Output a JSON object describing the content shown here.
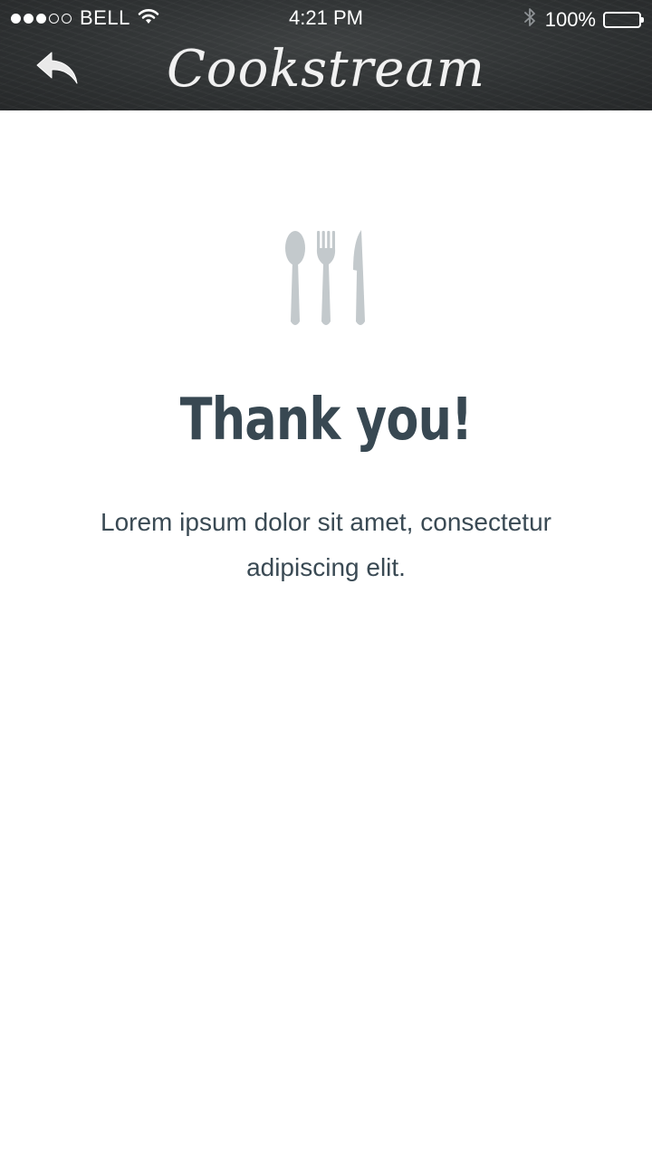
{
  "status_bar": {
    "signal_dots": [
      true,
      true,
      true,
      false,
      false
    ],
    "carrier": "BELL",
    "time": "4:21 PM",
    "battery": "100%",
    "battery_level": 1.0,
    "icons": [
      "wifi-icon",
      "bluetooth-icon",
      "battery-icon"
    ]
  },
  "header": {
    "title": "Cookstream",
    "back_icon": "reply-arrow-icon"
  },
  "content": {
    "icon": "utensils-icon",
    "title": "Thank you!",
    "message": "Lorem ipsum dolor sit amet, consectetur adipiscing elit."
  },
  "colors": {
    "header_bg": "#2e3132",
    "title_text": "#384852",
    "icon": "#c3c9cc",
    "background": "#ffffff"
  }
}
